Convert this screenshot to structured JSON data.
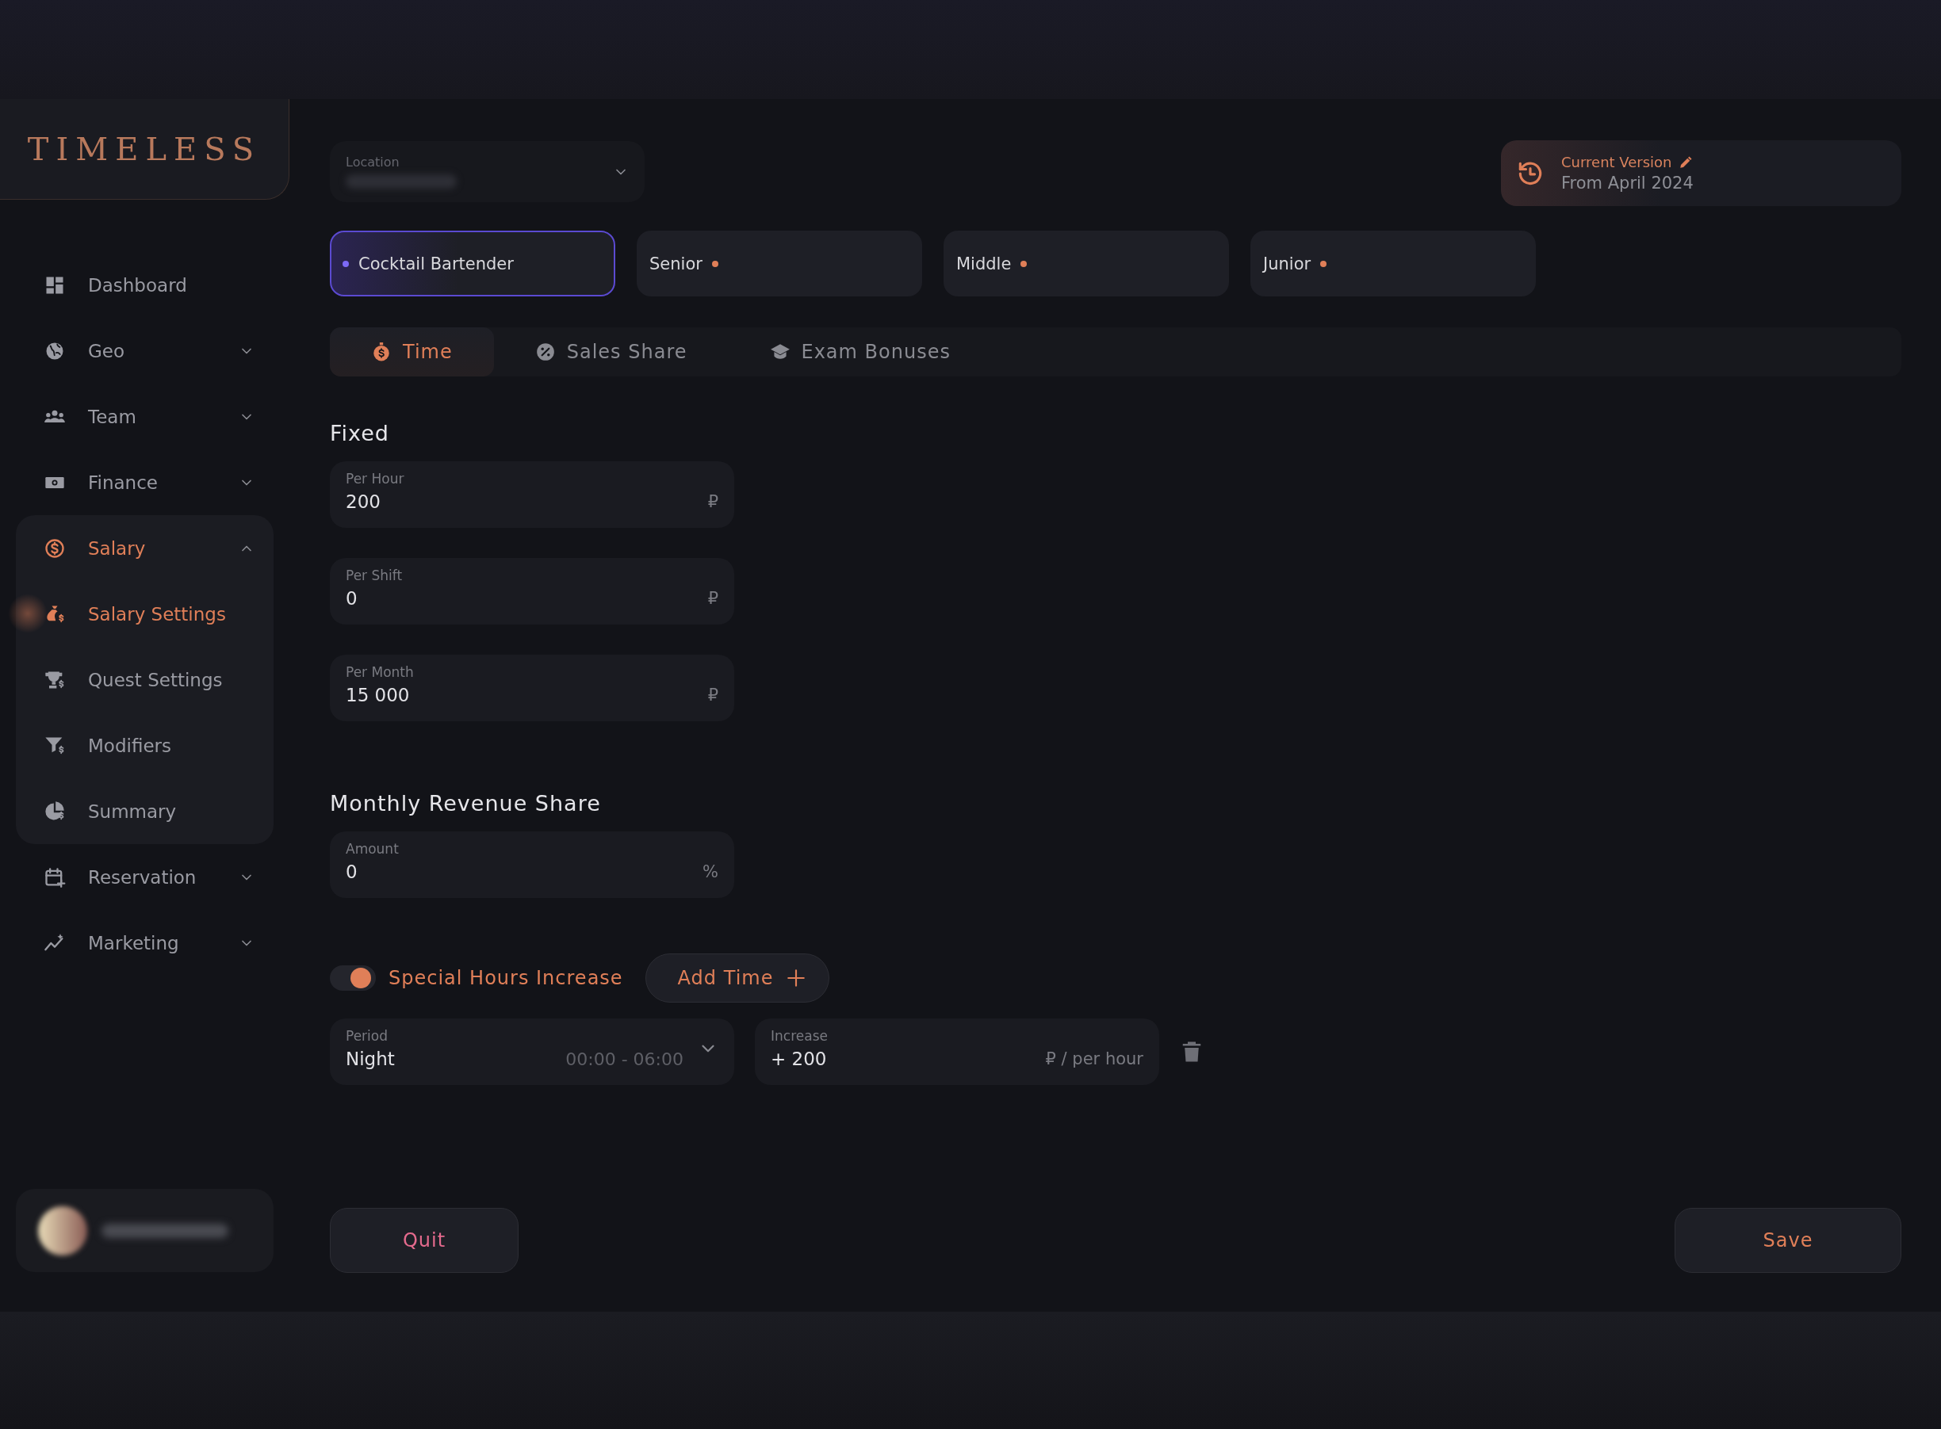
{
  "logo": "TIMELESS",
  "sidebar": {
    "items": [
      {
        "label": "Dashboard",
        "kind": "link",
        "selected": false
      },
      {
        "label": "Geo",
        "kind": "group",
        "expanded": false,
        "selected": false
      },
      {
        "label": "Team",
        "kind": "group",
        "expanded": false,
        "selected": false
      },
      {
        "label": "Finance",
        "kind": "group",
        "expanded": false,
        "selected": false
      },
      {
        "label": "Salary",
        "kind": "group",
        "expanded": true,
        "selected": true,
        "children": [
          {
            "label": "Salary Settings",
            "selected": true
          },
          {
            "label": "Quest Settings",
            "selected": false
          },
          {
            "label": "Modifiers",
            "selected": false
          },
          {
            "label": "Summary",
            "selected": false
          }
        ]
      },
      {
        "label": "Reservation",
        "kind": "group",
        "expanded": false,
        "selected": false
      },
      {
        "label": "Marketing",
        "kind": "group",
        "expanded": false,
        "selected": false
      }
    ]
  },
  "location": {
    "label": "Location"
  },
  "version": {
    "title": "Current Version",
    "subtitle": "From April 2024"
  },
  "roles": [
    {
      "label": "Cocktail Bartender",
      "selected": true
    },
    {
      "label": "Senior",
      "selected": false
    },
    {
      "label": "Middle",
      "selected": false
    },
    {
      "label": "Junior",
      "selected": false
    }
  ],
  "tabs": [
    {
      "label": "Time",
      "selected": true
    },
    {
      "label": "Sales Share",
      "selected": false
    },
    {
      "label": "Exam Bonuses",
      "selected": false
    }
  ],
  "fixed": {
    "title": "Fixed",
    "fields": [
      {
        "label": "Per Hour",
        "value": "200",
        "unit": "₽"
      },
      {
        "label": "Per Shift",
        "value": "0",
        "unit": "₽"
      },
      {
        "label": "Per Month",
        "value": "15 000",
        "unit": "₽"
      }
    ]
  },
  "revenue": {
    "title": "Monthly Revenue Share",
    "fields": [
      {
        "label": "Amount",
        "value": "0",
        "unit": "%"
      }
    ]
  },
  "special": {
    "label": "Special Hours Increase",
    "on": true,
    "add_button": "Add Time"
  },
  "periods": [
    {
      "period_label": "Period",
      "period": "Night",
      "range": "00:00 - 06:00",
      "increase_label": "Increase",
      "increase": "+ 200",
      "unit": "₽ / per hour"
    }
  ],
  "buttons": {
    "quit": "Quit",
    "save": "Save"
  }
}
